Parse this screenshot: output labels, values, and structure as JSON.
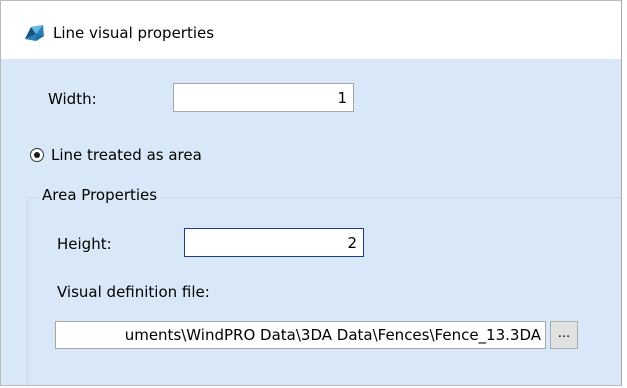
{
  "window": {
    "title": "Line visual properties",
    "icon": "app-logo-icon"
  },
  "width": {
    "label": "Width:",
    "value": "1"
  },
  "line_mode": {
    "label": "Line treated as area",
    "selected": true
  },
  "area_properties": {
    "group_title": "Area Properties",
    "height_label": "Height:",
    "height_value": "2",
    "file_label": "Visual definition file:",
    "file_value": "uments\\WindPRO Data\\3DA Data\\Fences\\Fence_13.3DA",
    "browse_label": "..."
  },
  "colors": {
    "background": "#d9e8f8",
    "focus_border": "#1f3b8c"
  }
}
